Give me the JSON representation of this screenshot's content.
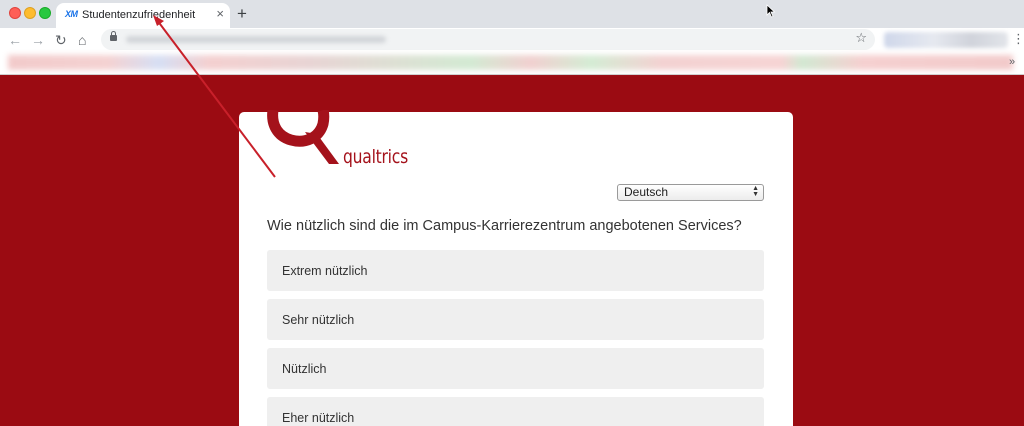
{
  "browser": {
    "tab": {
      "favicon_text": "XM",
      "title": "Studentenzufriedenheit",
      "close": "×"
    },
    "new_tab": "+",
    "nav": {
      "back": "←",
      "forward": "→",
      "reload": "↻",
      "home": "⌂",
      "star": "☆",
      "menu": "⋮"
    },
    "bookmarks_more": "»"
  },
  "survey": {
    "logo_text": "qualtrics",
    "language": "Deutsch",
    "question": "Wie nützlich sind die im Campus-Karrierezentrum angebotenen Services?",
    "options": [
      "Extrem nützlich",
      "Sehr nützlich",
      "Nützlich",
      "Eher nützlich"
    ]
  },
  "colors": {
    "brand": "#9b0b12",
    "logo": "#a4121b",
    "annotation": "#c8202a"
  }
}
